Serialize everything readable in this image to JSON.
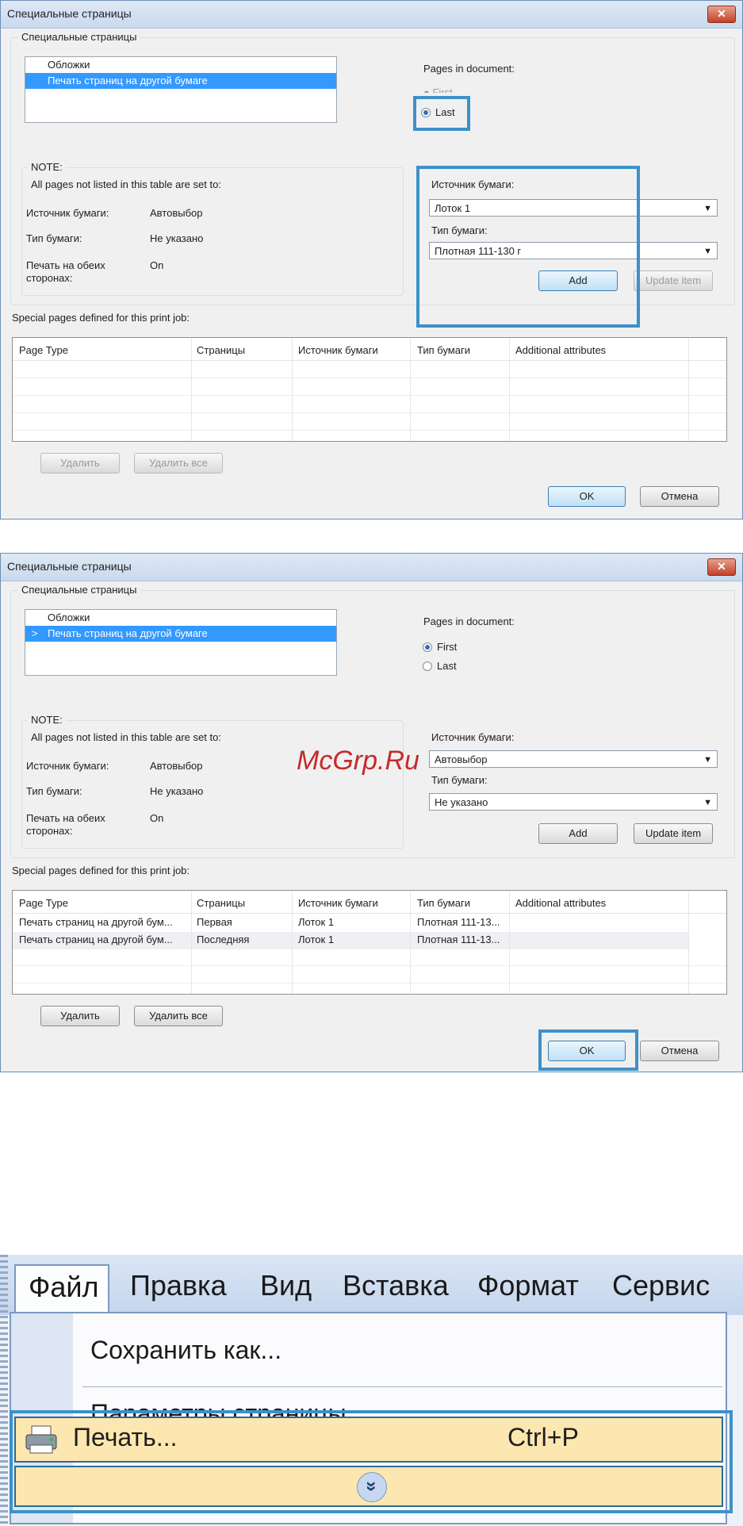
{
  "dialog1": {
    "title": "Специальные страницы",
    "close": "✕",
    "group_title": "Специальные страницы",
    "list": [
      "Обложки",
      "Печать страниц на другой бумаге"
    ],
    "pages_label": "Pages in document:",
    "radio_first": "First",
    "radio_last": "Last",
    "note_title": "NOTE:",
    "note_text": "All pages not listed in this table are set to:",
    "source_label": "Источник бумаги:",
    "source_value": "Автовыбор",
    "type_label": "Тип бумаги:",
    "type_value": "Не указано",
    "duplex_label_1": "Печать на обеих",
    "duplex_label_2": "сторонах:",
    "duplex_value": "On",
    "right_source_label": "Источник бумаги:",
    "right_source_value": "Лоток 1",
    "right_type_label": "Тип бумаги:",
    "right_type_value": "Плотная 111-130 г",
    "add": "Add",
    "update": "Update item",
    "special_label": "Special pages defined for this print job:",
    "columns": [
      "Page Type",
      "Страницы",
      "Источник бумаги",
      "Тип бумаги",
      "Additional attributes"
    ],
    "delete": "Удалить",
    "delete_all": "Удалить все",
    "ok": "OK",
    "cancel": "Отмена"
  },
  "dialog2": {
    "title": "Специальные страницы",
    "close": "✕",
    "group_title": "Специальные страницы",
    "list": [
      "Обложки",
      "Печать страниц на другой бумаге"
    ],
    "list_marker": ">",
    "pages_label": "Pages in document:",
    "radio_first": "First",
    "radio_last": "Last",
    "note_title": "NOTE:",
    "note_text": "All pages not listed in this table are set to:",
    "source_label": "Источник бумаги:",
    "source_value": "Автовыбор",
    "type_label": "Тип бумаги:",
    "type_value": "Не указано",
    "duplex_label_1": "Печать на обеих",
    "duplex_label_2": "сторонах:",
    "duplex_value": "On",
    "right_source_label": "Источник бумаги:",
    "right_source_value": "Автовыбор",
    "right_type_label": "Тип бумаги:",
    "right_type_value": "Не указано",
    "add": "Add",
    "update": "Update item",
    "special_label": "Special pages defined for this print job:",
    "columns": [
      "Page Type",
      "Страницы",
      "Источник бумаги",
      "Тип бумаги",
      "Additional attributes"
    ],
    "rows": [
      [
        "Печать страниц на другой бум...",
        "Первая",
        "Лоток 1",
        "Плотная 111-13..."
      ],
      [
        "Печать страниц на другой бум...",
        "Последняя",
        "Лоток 1",
        "Плотная 111-13..."
      ]
    ],
    "delete": "Удалить",
    "delete_all": "Удалить все",
    "ok": "OK",
    "cancel": "Отмена"
  },
  "watermark": "McGrp.Ru",
  "menu": {
    "bar": [
      "Файл",
      "Правка",
      "Вид",
      "Вставка",
      "Формат",
      "Сервис"
    ],
    "save_as": "Сохранить как...",
    "page_setup": "Параметры страницы...",
    "print": "Печать...",
    "print_shortcut": "Ctrl+P",
    "expand": "»"
  },
  "colors": {
    "highlight": "#3d91c9",
    "selection": "#3399ff",
    "menu_hover": "#fde7b0"
  }
}
